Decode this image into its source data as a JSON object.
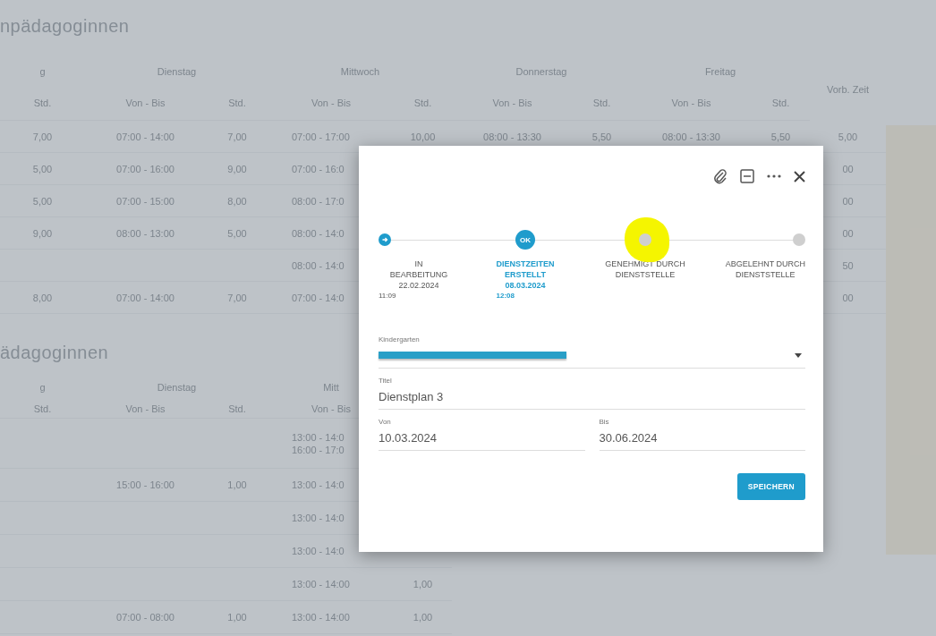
{
  "sections": [
    {
      "title": "npädagoginnen",
      "groups": [
        {
          "label": "g",
          "subheaders": [
            "Std."
          ]
        },
        {
          "label": "Dienstag",
          "subheaders": [
            "Von - Bis",
            "Std."
          ]
        },
        {
          "label": "Mittwoch",
          "subheaders": [
            "Von - Bis",
            "Std."
          ]
        },
        {
          "label": "Donnerstag",
          "subheaders": [
            "Von - Bis",
            "Std."
          ]
        },
        {
          "label": "Freitag",
          "subheaders": [
            "Von - Bis",
            "Std."
          ]
        },
        {
          "label": "Vorb. Zeit"
        }
      ],
      "rows": [
        [
          "7,00",
          "07:00 - 14:00",
          "7,00",
          "07:00 - 17:00",
          "10,00",
          "08:00 - 13:30",
          "5,50",
          "08:00 - 13:30",
          "5,50",
          "5,00"
        ],
        [
          "5,00",
          "07:00 - 16:00",
          "9,00",
          "07:00 - 16:0",
          null,
          null,
          null,
          null,
          null,
          "00"
        ],
        [
          "5,00",
          "07:00 - 15:00",
          "8,00",
          "08:00 - 17:0",
          null,
          null,
          null,
          null,
          null,
          "00"
        ],
        [
          "9,00",
          "08:00 - 13:00",
          "5,00",
          "08:00 - 14:0",
          null,
          null,
          null,
          null,
          null,
          "00"
        ],
        [
          null,
          null,
          null,
          "08:00 - 14:0",
          null,
          null,
          null,
          null,
          null,
          "50"
        ],
        [
          "8,00",
          "07:00 - 14:00",
          "7,00",
          "07:00 - 14:0",
          null,
          null,
          null,
          null,
          null,
          "00"
        ]
      ]
    },
    {
      "title": "ädagoginnen",
      "groups": [
        {
          "label": "g",
          "subheaders": [
            "Std."
          ]
        },
        {
          "label": "Dienstag",
          "subheaders": [
            "Von - Bis",
            "Std."
          ]
        },
        {
          "label": "Mitt",
          "subheaders": [
            "Von - Bis"
          ]
        }
      ],
      "rows": [
        [
          null,
          null,
          null,
          [
            "13:00 - 14:0",
            "16:00 - 17:0"
          ],
          null
        ],
        [
          null,
          "15:00 - 16:00",
          "1,00",
          "13:00 - 14:0",
          null
        ],
        [
          null,
          null,
          null,
          "13:00 - 14:0",
          null
        ],
        [
          null,
          null,
          null,
          "13:00 - 14:0",
          null
        ],
        [
          null,
          null,
          null,
          "13:00 - 14:00",
          "1,00"
        ],
        [
          null,
          "07:00 - 08:00",
          "1,00",
          "13:00 - 14:00",
          "1,00"
        ]
      ]
    }
  ],
  "dialog": {
    "toolbar": [
      {
        "kind": "attach"
      },
      {
        "kind": "minimize"
      },
      {
        "kind": "more"
      },
      {
        "kind": "close"
      }
    ],
    "steps": [
      {
        "kind": "done",
        "lines": [
          "IN",
          "BEARBEITUNG",
          "22.02.2024"
        ],
        "time": "11:09",
        "highlighted": false
      },
      {
        "kind": "current",
        "badge": "OK",
        "lines": [
          "DIENSTZEITEN",
          "ERSTELLT",
          "08.03.2024"
        ],
        "time": "12:08",
        "highlighted": false
      },
      {
        "kind": "pending",
        "lines": [
          "GENEHMIGT DURCH",
          "DIENSTSTELLE"
        ],
        "highlighted": true
      },
      {
        "kind": "pending",
        "lines": [
          "ABGELEHNT DURCH",
          "DIENSTSTELLE"
        ],
        "highlighted": false
      }
    ],
    "kindergarten": {
      "label": "Kindergarten",
      "redacted": true
    },
    "title_field": {
      "label": "Titel",
      "value": "Dienstplan 3"
    },
    "von": {
      "label": "Von",
      "value": "10.03.2024"
    },
    "bis": {
      "label": "Bis",
      "value": "30.06.2024"
    },
    "save": "SPEICHERN"
  }
}
